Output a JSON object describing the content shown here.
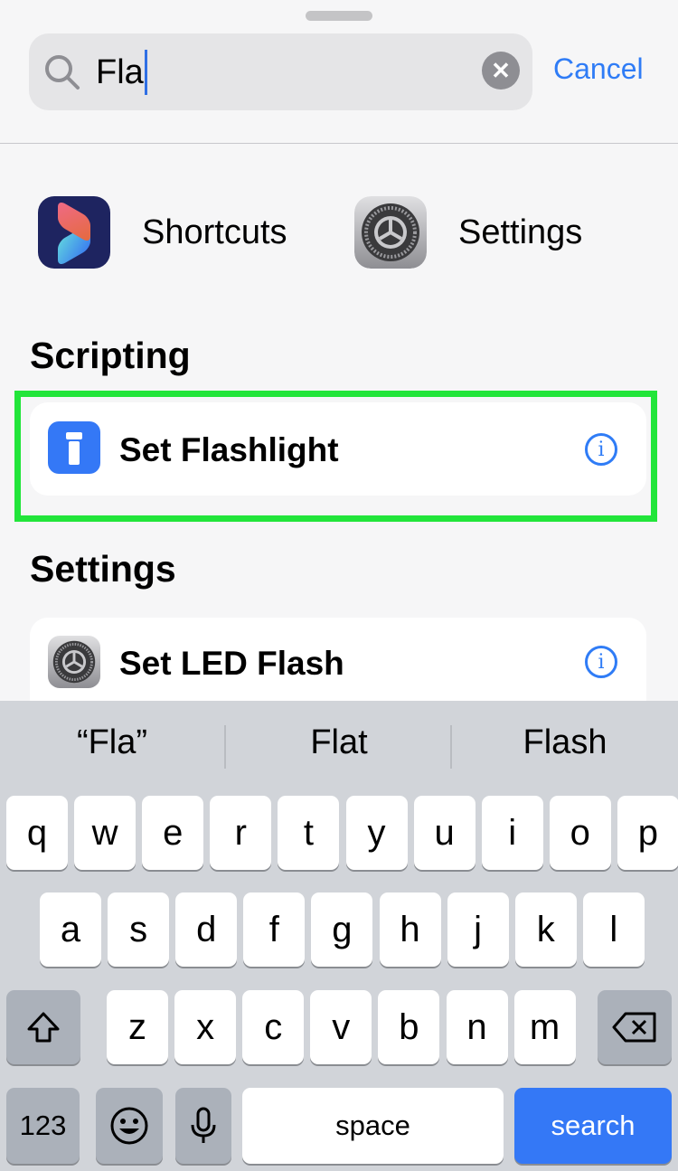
{
  "search": {
    "query": "Fla",
    "cancel_label": "Cancel"
  },
  "apps": [
    {
      "label": "Shortcuts",
      "icon": "shortcuts-app-icon"
    },
    {
      "label": "Settings",
      "icon": "settings-gear-icon"
    }
  ],
  "sections": [
    {
      "title": "Scripting",
      "items": [
        {
          "label": "Set Flashlight",
          "icon": "flashlight-icon",
          "highlighted": true
        }
      ]
    },
    {
      "title": "Settings",
      "items": [
        {
          "label": "Set LED Flash",
          "icon": "settings-gear-icon"
        }
      ]
    }
  ],
  "keyboard": {
    "suggestions": [
      "“Fla”",
      "Flat",
      "Flash"
    ],
    "row1": [
      "q",
      "w",
      "e",
      "r",
      "t",
      "y",
      "u",
      "i",
      "o",
      "p"
    ],
    "row2": [
      "a",
      "s",
      "d",
      "f",
      "g",
      "h",
      "j",
      "k",
      "l"
    ],
    "row3": [
      "z",
      "x",
      "c",
      "v",
      "b",
      "n",
      "m"
    ],
    "numbers_label": "123",
    "space_label": "space",
    "search_label": "search"
  },
  "colors": {
    "accent": "#2f7cf6",
    "highlight": "#22e53a",
    "search_key": "#3478f6"
  }
}
